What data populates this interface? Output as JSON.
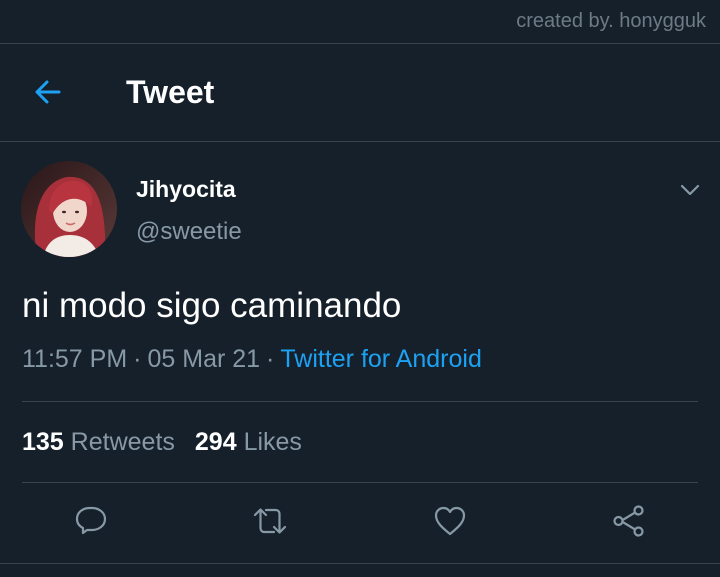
{
  "credit": "created by. honygguk",
  "header": {
    "title": "Tweet"
  },
  "tweet": {
    "display_name": "Jihyocita",
    "handle": "@sweetie",
    "text": "ni modo sigo caminando",
    "time": "11:57 PM",
    "date": "05 Mar 21",
    "source": "Twitter for Android",
    "separator": "·"
  },
  "stats": {
    "retweets_count": "135",
    "retweets_label": "Retweets",
    "likes_count": "294",
    "likes_label": "Likes"
  },
  "colors": {
    "background": "#15202b",
    "accent": "#1da1f2",
    "secondary_text": "#8899a6",
    "divider": "#38444d"
  },
  "icons": {
    "back": "arrow-left-icon",
    "more": "chevron-down-icon",
    "reply": "reply-icon",
    "retweet": "retweet-icon",
    "like": "heart-icon",
    "share": "share-icon"
  }
}
